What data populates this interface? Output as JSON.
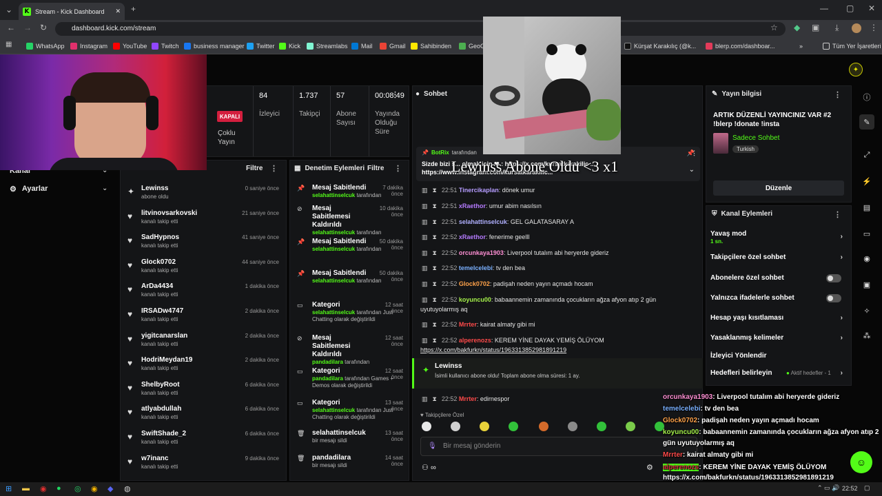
{
  "browser": {
    "tab_title": "Stream - Kick Dashboard",
    "url": "dashboard.kick.com/stream",
    "bookmarks": [
      "WhatsApp",
      "Instagram",
      "YouTube",
      "Twitch",
      "business manager",
      "Twitter",
      "Kick",
      "Streamlabs",
      "Mail",
      "Gmail",
      "Sahibinden",
      "GeoG",
      "Kürşat Karakılıç (@k...",
      "blerp.com/dashboar..."
    ],
    "all_bookmarks": "Tüm Yer İşaretleri"
  },
  "stats": {
    "status": "KAPALI",
    "multi": "Çoklu Yayın",
    "viewers_value": "84",
    "viewers_label": "İzleyici",
    "followers_value": "1.737",
    "followers_label": "Takipçi",
    "subs_value": "57",
    "subs_label": "Abone Sayısı",
    "duration_value": "00:08:49",
    "duration_label": "Yayında Olduğu Süre"
  },
  "left_nav": {
    "item1": "Kanal",
    "item2": "Ayarlar"
  },
  "activity": {
    "filter": "Filtre",
    "items": [
      {
        "name": "Lewinss",
        "sub": "abone oldu",
        "time": "0 saniye önce"
      },
      {
        "name": "litvinovsarkovski",
        "sub": "kanalı takip etti",
        "time": "21 saniye önce"
      },
      {
        "name": "SadHypnos",
        "sub": "kanalı takip etti",
        "time": "41 saniye önce"
      },
      {
        "name": "Glock0702",
        "sub": "kanalı takip etti",
        "time": "44 saniye önce"
      },
      {
        "name": "ArDa4434",
        "sub": "kanalı takip etti",
        "time": "1 dakika önce"
      },
      {
        "name": "IRSADw4747",
        "sub": "kanalı takip etti",
        "time": "2 dakika önce"
      },
      {
        "name": "yigitcanarslan",
        "sub": "kanalı takip etti",
        "time": "2 dakika önce"
      },
      {
        "name": "HodriMeydan19",
        "sub": "kanalı takip etti",
        "time": "2 dakika önce"
      },
      {
        "name": "ShelbyRoot",
        "sub": "kanalı takip etti",
        "time": "6 dakika önce"
      },
      {
        "name": "atlyabdullah",
        "sub": "kanalı takip etti",
        "time": "6 dakika önce"
      },
      {
        "name": "SwiftShade_2",
        "sub": "kanalı takip etti",
        "time": "6 dakika önce"
      },
      {
        "name": "w7inanc",
        "sub": "kanalı takip etti",
        "time": "9 dakika önce"
      }
    ]
  },
  "moderation": {
    "title": "Denetim Eylemleri",
    "filter": "Filtre",
    "items": [
      {
        "title": "Mesaj Sabitlendi",
        "user": "selahattinselcuk",
        "rest": " tarafından",
        "time": "7 dakika önce"
      },
      {
        "title": "Mesaj Sabitlemesi Kaldırıldı",
        "user": "selahattinselcuk",
        "rest": " tarafından",
        "time": "10 dakika önce"
      },
      {
        "title": "Mesaj Sabitlendi",
        "user": "selahattinselcuk",
        "rest": " tarafından",
        "time": "50 dakika önce"
      },
      {
        "title": "Mesaj Sabitlendi",
        "user": "selahattinselcuk",
        "rest": " tarafından",
        "time": "50 dakika önce"
      },
      {
        "title": "Kategori",
        "user": "selahattinselcuk",
        "rest": " tarafından Just Chatting olarak değiştirildi",
        "time": "12 saat önce"
      },
      {
        "title": "Mesaj Sabitlemesi Kaldırıldı",
        "user": "pandadilara",
        "rest": " tarafından",
        "time": "12 saat önce"
      },
      {
        "title": "Kategori",
        "user": "pandadilara",
        "rest": " tarafından Games + Demos olarak değiştirildi",
        "time": "12 saat önce"
      },
      {
        "title": "Kategori",
        "user": "selahattinselcuk",
        "rest": " tarafından Just Chatting olarak değiştirildi",
        "time": "13 saat önce"
      },
      {
        "title": "selahattinselcuk",
        "user": "",
        "rest": "bir mesajı sildi",
        "time": "13 saat önce"
      },
      {
        "title": "pandadilara",
        "user": "",
        "rest": "bir mesajı sildi",
        "time": "14 saat önce"
      }
    ]
  },
  "chat": {
    "title": "Sohbet",
    "pinned_by": "BotRix",
    "pinned_by_rest": " tarafından",
    "pinned_text": "Sizde bizi s... olmak için ❤ : https://x.com/kursatkarakilic ... https://www.instagram.com/kursatkarakilic...",
    "overlay_alert": "Lewinss Abone Oldu <3 x1",
    "lines": [
      {
        "time": "22:51",
        "user": "Tinercikaplan",
        "color": "#b59cff",
        "text": ": dönek umur"
      },
      {
        "time": "22:51",
        "user": "xRaethor",
        "color": "#b57bff",
        "text": ": umur abim nasılsın"
      },
      {
        "time": "22:51",
        "user": "selahattinselcuk",
        "color": "#b0b0ff",
        "text": ": GEL GALATASARAY A"
      },
      {
        "time": "22:52",
        "user": "xRaethor",
        "color": "#b57bff",
        "text": ": fenerime geelll"
      },
      {
        "time": "22:52",
        "user": "orcunkaya1903",
        "color": "#ff8fd4",
        "text": ": Liverpool tutalım abi heryerde gideriz"
      },
      {
        "time": "22:52",
        "user": "temelcelebi",
        "color": "#7ab0ff",
        "text": ": tv den bea"
      },
      {
        "time": "22:52",
        "user": "Glock0702",
        "color": "#ffa24a",
        "text": ": padişah neden yayın açmadı hocam"
      },
      {
        "time": "22:52",
        "user": "koyuncu00",
        "color": "#a4f04a",
        "text": ": babaannemin zamanında çocukların ağza afyon atıp 2 gün"
      },
      {
        "time": "",
        "user": "",
        "color": "#e6e6e6",
        "text": "uyutuyolarmış aq"
      },
      {
        "time": "22:52",
        "user": "Mrrter",
        "color": "#ff4a4a",
        "text": ": kairat almaty gibi mi"
      },
      {
        "time": "22:52",
        "user": "alperenozs",
        "color": "#ff4a4a",
        "text": ": KEREM YİNE DAYAK YEMİŞ ÖLÜYOM"
      },
      {
        "time": "",
        "user": "",
        "color": "#e6e6e6",
        "text": "https://x.com/bakfurkn/status/1963313852981891219"
      }
    ],
    "sub_alert_user": "Lewinss",
    "sub_alert_text": "İsimli kullanıcı abone oldu! Toplam abone olma süresi: 1 ay.",
    "last_line": {
      "time": "22:52",
      "user": "Mrrter",
      "text": ": edirnespor"
    },
    "emote_label": "Takipçilere Özel",
    "input_placeholder": "Bir mesaj gönderin"
  },
  "stream_info": {
    "title": "Yayın bilgisi",
    "stream_title": "ARTIK DÜZENLİ YAYINCINIZ VAR #2 !blerp !donate !insta",
    "category": "Sadece Sohbet",
    "tag": "Turkish",
    "edit": "Düzenle"
  },
  "channel_actions": {
    "title": "Kanal Eylemleri",
    "slow_mode": "Yavaş mod",
    "slow_value": "1 sn.",
    "followers_only": "Takipçilere özel sohbet",
    "subs_only": "Abonelere özel sohbet",
    "emotes_only": "Yalnızca ifadelerle sohbet",
    "account_age": "Hesap yaşı kısıtlaması",
    "banned_words": "Yasaklanmış kelimeler",
    "viewer_redirect": "İzleyici Yönlendir",
    "goals": "Hedefleri belirleyin",
    "goals_active": "Aktif hedefler - 1"
  },
  "overlay_chat": [
    {
      "user": "orcunkaya1903",
      "color": "#ff8fd4",
      "text": ": Liverpool tutalım abi heryerde gideriz"
    },
    {
      "user": "temelcelebi",
      "color": "#7ab0ff",
      "text": ": tv den bea"
    },
    {
      "user": "Glock0702",
      "color": "#ffa24a",
      "text": ": padişah neden yayın açmadı hocam"
    },
    {
      "user": "koyuncu00",
      "color": "#a4f04a",
      "text": ": babaannemin zamanında çocukların ağza afyon atıp 2"
    },
    {
      "user": "",
      "color": "#fff",
      "text": "gün uyutuyolarmış aq"
    },
    {
      "user": "Mrrter",
      "color": "#ff4a4a",
      "text": ": kairat almaty gibi mi"
    },
    {
      "user": "alperenozs",
      "color": "#ff4a4a",
      "text": ": KEREM YİNE DAYAK YEMİŞ ÖLÜYOM"
    },
    {
      "user": "",
      "color": "#fff",
      "text": "https://x.com/bakfurkn/status/1963313852981891219"
    },
    {
      "user": "Mrrter",
      "color": "#ff4a4a",
      "text": ": edirnespor"
    }
  ],
  "taskbar": {
    "time": "22:52"
  },
  "colors": {
    "accent": "#53fc18",
    "bg": "#070707",
    "panel": "#141517"
  }
}
